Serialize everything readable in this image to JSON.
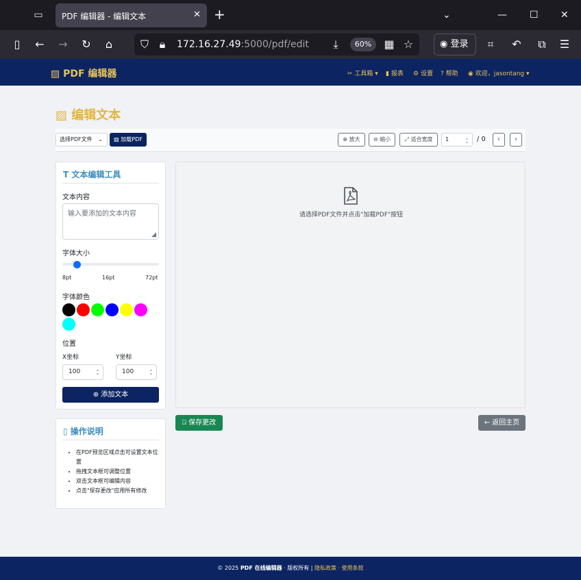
{
  "browser": {
    "tab_title": "PDF 编辑器 - 编辑文本",
    "url_host": "172.16.27.49",
    "url_path": ":5000/pdf/edit",
    "zoom": "60%",
    "login_label": "登录"
  },
  "header": {
    "brand": "PDF 编辑器",
    "menu": {
      "tools": "工具箱",
      "report": "报表",
      "settings": "设置",
      "help": "帮助",
      "user": "欢迎，jasontang"
    }
  },
  "page": {
    "title": "编辑文本"
  },
  "toolbar": {
    "select_file": "选择PDF文件",
    "load_pdf": "加载PDF",
    "zoom_in": "放大",
    "zoom_out": "缩小",
    "fit_width": "适合宽度",
    "page_number": "1",
    "page_total": "/ 0"
  },
  "text_tools": {
    "title": "文本编辑工具",
    "content_label": "文本内容",
    "content_placeholder": "输入要添加的文本内容",
    "font_size_label": "字体大小",
    "font_size_value": 16,
    "font_size_min_label": "8pt",
    "font_size_mid_label": "16pt",
    "font_size_max_label": "72pt",
    "font_color_label": "字体颜色",
    "colors": [
      "#000000",
      "#ff0000",
      "#00ff00",
      "#0000ff",
      "#ffff00",
      "#ff00ff",
      "#00ffff"
    ],
    "position_label": "位置",
    "x_label": "X坐标",
    "y_label": "Y坐标",
    "x_value": "100",
    "y_value": "100",
    "add_text": "添加文本"
  },
  "instructions": {
    "title": "操作说明",
    "items": [
      "在PDF预览区域点击可设置文本位置",
      "拖拽文本框可调整位置",
      "双击文本框可编辑内容",
      "点击\"保存更改\"应用所有修改"
    ]
  },
  "preview": {
    "message": "请选择PDF文件并点击\"加载PDF\"按钮"
  },
  "actions": {
    "save": "保存更改",
    "back": "返回主页"
  },
  "footer": {
    "copyright": "© 2025",
    "brand": "PDF 在线编辑器",
    "rights": "· 版权所有 |",
    "privacy": "隐私政策",
    "sep": "·",
    "terms": "使用条款"
  },
  "colors": {
    "brand_navy": "#0c2461",
    "brand_gold": "#e7c25b",
    "panel_title_blue": "#3c8dbc",
    "save_green": "#198754"
  }
}
